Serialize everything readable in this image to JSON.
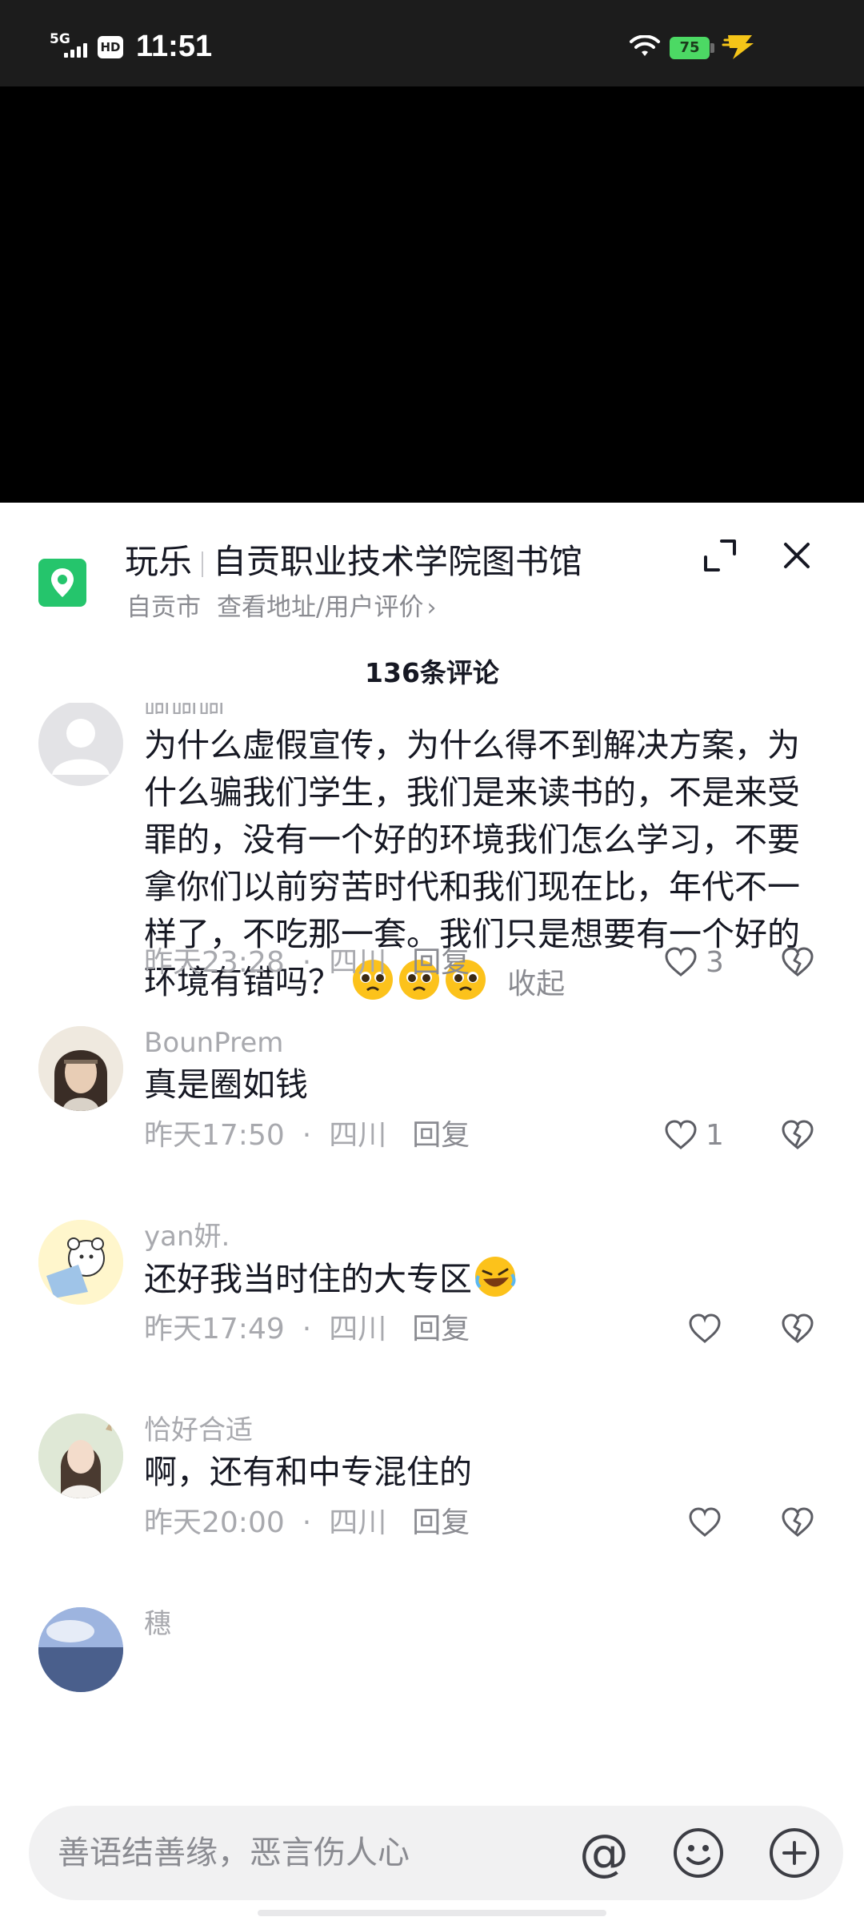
{
  "status_bar": {
    "network": "5G",
    "hd": "HD",
    "time": "11:51",
    "battery": "75"
  },
  "poi": {
    "category": "玩乐",
    "name": "自贡职业技术学院图书馆",
    "city": "自贡市",
    "link": "查看地址/用户评价",
    "chevron": "›",
    "icon_color": "#25c56c"
  },
  "comments_header": "136条评论",
  "comments": [
    {
      "username": "呵呵呵.",
      "text": "为什么虚假宣传，为什么得不到解决方案，为什么骗我们学生，我们是来读书的，不是来受罪的，没有一个好的环境我们怎么学习，不要拿你们以前穷苦时代和我们现在比，年代不一样了，不吃那一套。我们只是想要有一个好的环境有错吗？",
      "collapse": "收起",
      "time": "昨天23:28",
      "location": "四川",
      "reply": "回复",
      "likes": "3"
    },
    {
      "username": "BounPrem",
      "text": "真是圈如钱",
      "time": "昨天17:50",
      "location": "四川",
      "reply": "回复",
      "likes": "1"
    },
    {
      "username": "yan妍.",
      "text": "还好我当时住的大专区",
      "time": "昨天17:49",
      "location": "四川",
      "reply": "回复",
      "likes": ""
    },
    {
      "username": "恰好合适",
      "text": "啊，还有和中专混住的",
      "time": "昨天20:00",
      "location": "四川",
      "reply": "回复",
      "likes": ""
    },
    {
      "username": "穗"
    }
  ],
  "meta_separator": "·",
  "input": {
    "placeholder": "善语结善缘，恶言伤人心",
    "at_symbol": "@"
  },
  "icons": {
    "poi": "location-pin-icon",
    "expand": "expand-icon",
    "close": "close-icon",
    "like": "heart-icon",
    "dislike": "broken-heart-icon",
    "emoji": "smiley-icon",
    "plus": "plus-circle-icon"
  }
}
